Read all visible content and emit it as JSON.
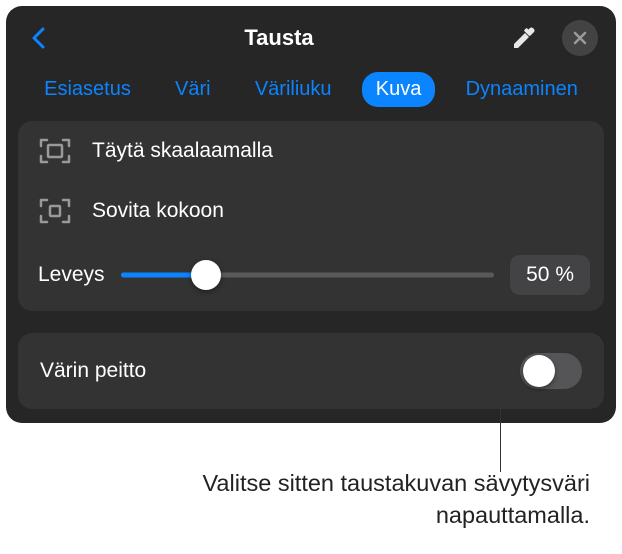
{
  "header": {
    "title": "Tausta"
  },
  "tabs": {
    "items": [
      {
        "label": "Esiasetus"
      },
      {
        "label": "Väri"
      },
      {
        "label": "Väriliuku"
      },
      {
        "label": "Kuva"
      },
      {
        "label": "Dynaaminen"
      }
    ]
  },
  "options": {
    "scale_fill": "Täytä skaalaamalla",
    "fit": "Sovita kokoon"
  },
  "slider": {
    "label": "Leveys",
    "value": "50 %"
  },
  "toggle": {
    "label": "Värin peitto"
  },
  "callout": {
    "text": "Valitse sitten taustakuvan sävytysväri napauttamalla."
  }
}
